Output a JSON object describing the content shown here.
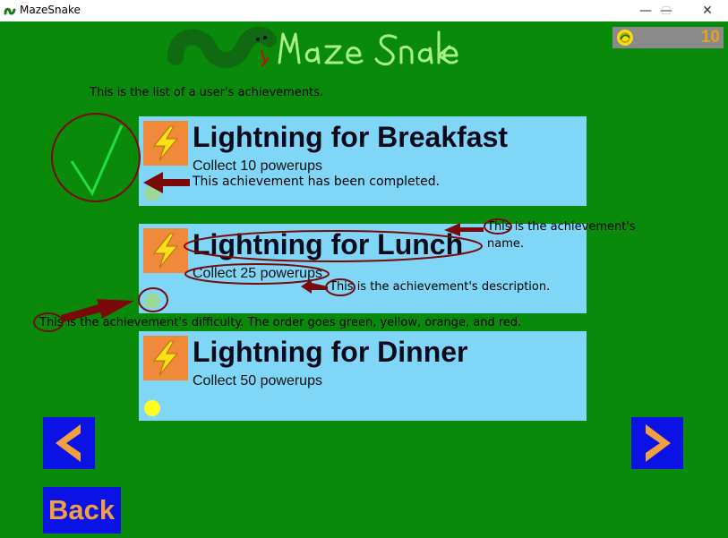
{
  "window": {
    "title": "MazeSnake",
    "minimize_glyph": "—",
    "maximize_glyph": "☐",
    "close_glyph": "✕"
  },
  "header": {
    "coin_count": "10",
    "coin_icon": "coin-icon"
  },
  "intro_text": "This is the list of a user's achievements.",
  "achievements": [
    {
      "name": "Lightning for Breakfast",
      "description": "Collect 10 powerups",
      "difficulty_color": "#9bd99b",
      "icon": "lightning-icon",
      "completed": true,
      "completed_note": "This achievement has been completed."
    },
    {
      "name": "Lightning for Lunch",
      "description": "Collect 25 powerups",
      "difficulty_color": "#9bd99b",
      "icon": "lightning-icon",
      "completed": false
    },
    {
      "name": "Lightning for Dinner",
      "description": "Collect 50 powerups",
      "difficulty_color": "#ffff22",
      "icon": "lightning-icon",
      "completed": false
    }
  ],
  "annotations": {
    "name_line1": "This is the achievement's",
    "name_line2": "name.",
    "description": "This is the achievement's description.",
    "difficulty": "This is the achievement's difficulty. The order goes green, yellow, orange, and red."
  },
  "navigation": {
    "back_label": "Back",
    "prev_icon": "chevron-left-icon",
    "next_icon": "chevron-right-icon"
  },
  "colors": {
    "background": "#0a8a0a",
    "card": "#7fd6f7",
    "icon_bg": "#f08a3a",
    "button": "#0a12e6",
    "button_accent": "#f0a040",
    "annotation": "#7a0a0a"
  }
}
